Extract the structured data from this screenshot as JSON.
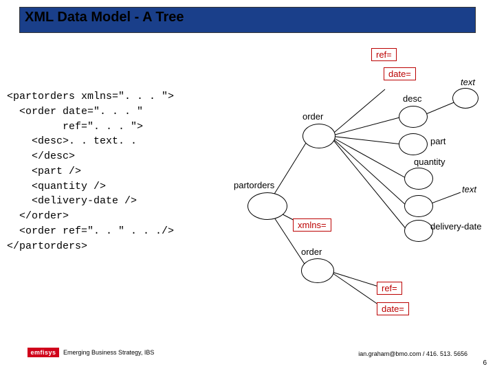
{
  "title": "XML Data Model - A Tree",
  "code_lines": [
    "<partorders xmlns=\". . . \">",
    "  <order date=\". . . \"",
    "         ref=\". . . \">",
    "    <desc>. . text. .",
    "    </desc>",
    "    <part />",
    "    <quantity />",
    "    <delivery-date />",
    "  </order>",
    "  <order ref=\". . \" . . ./>",
    "</partorders>"
  ],
  "nodes": {
    "partorders": "partorders",
    "xmlns": "xmlns=",
    "order1": "order",
    "order2": "order",
    "ref1": "ref=",
    "date1": "date=",
    "ref2": "ref=",
    "date2": "date=",
    "desc": "desc",
    "part": "part",
    "quantity": "quantity",
    "delivery_date": "delivery-date",
    "text1": "text",
    "text2": "text"
  },
  "footer": {
    "logo": "emfisys",
    "org": "Emerging Business Strategy, IBS",
    "contact": "ian.graham@bmo.com / 416. 513. 5656",
    "page": "6"
  }
}
